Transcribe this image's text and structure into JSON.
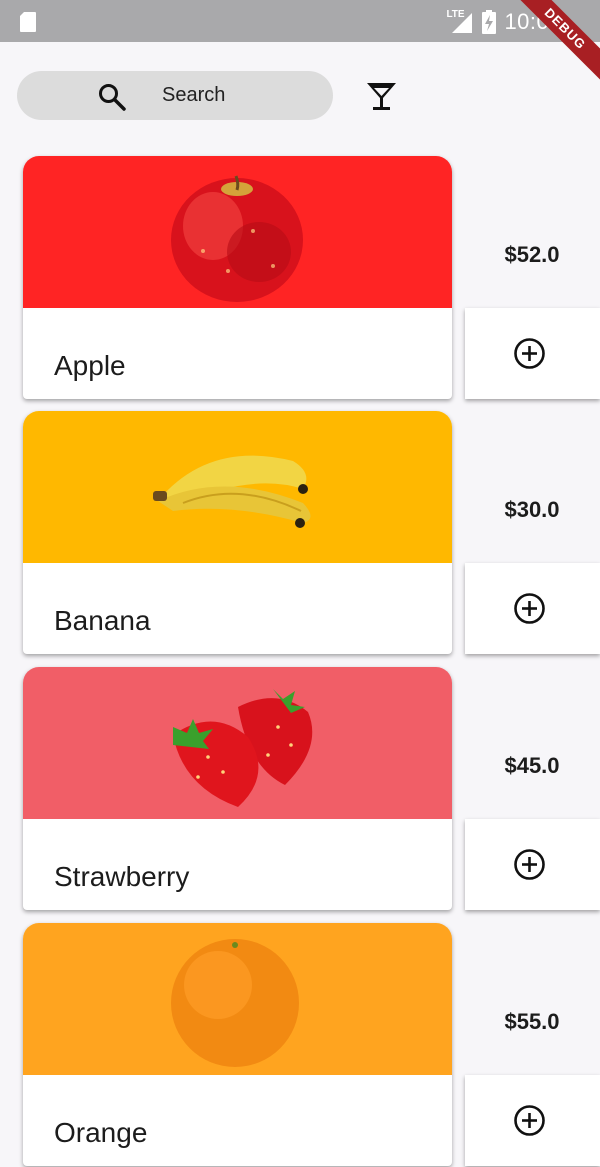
{
  "status_bar": {
    "network": "LTE",
    "time": "10:09",
    "debug_banner": "DEBUG"
  },
  "search": {
    "label": "Search"
  },
  "products": [
    {
      "name": "Apple",
      "price": "$52.0",
      "image": "apple",
      "bg_color": "#ff2424"
    },
    {
      "name": "Banana",
      "price": "$30.0",
      "image": "banana",
      "bg_color": "#ffb800"
    },
    {
      "name": "Strawberry",
      "price": "$45.0",
      "image": "strawberry",
      "bg_color": "#f15e67"
    },
    {
      "name": "Orange",
      "price": "$55.0",
      "image": "orange",
      "bg_color": "#ffa41f"
    }
  ],
  "icons": {
    "search": "search-icon",
    "filter": "cocktail-glass-icon",
    "add": "add-circle-outline-icon"
  }
}
